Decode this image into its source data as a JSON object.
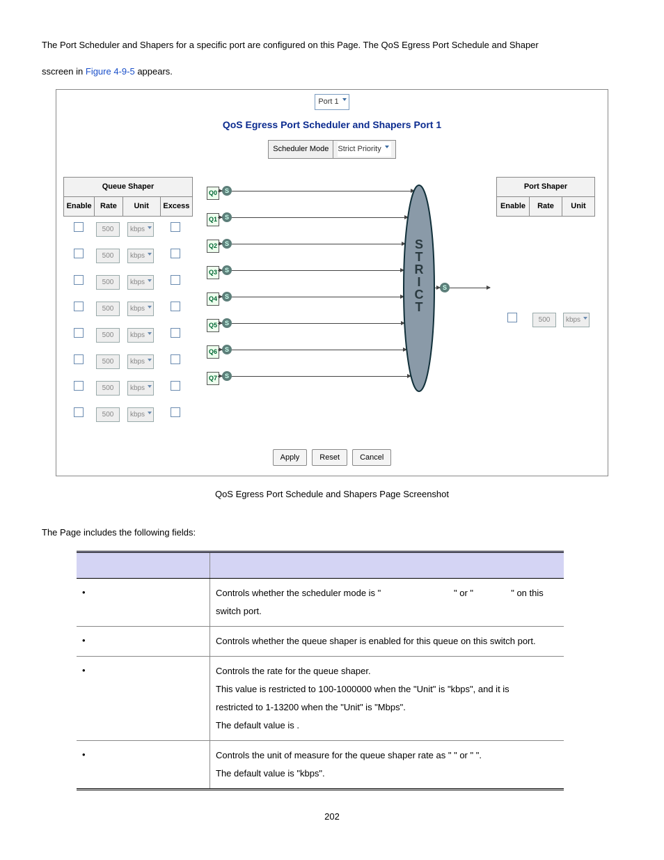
{
  "intro": {
    "line1_a": "The Port Scheduler and Shapers for a specific port are configured on this Page. The QoS Egress Port Schedule and Shaper",
    "line2_a": "sscreen in ",
    "figref": "Figure 4-9-5",
    "line2_b": " appears."
  },
  "ss": {
    "port_select": "Port 1",
    "title": "QoS Egress Port Scheduler and Shapers  Port 1",
    "sched_label": "Scheduler Mode",
    "sched_value": "Strict Priority",
    "queue_shaper_hdr": "Queue Shaper",
    "port_shaper_hdr": "Port Shaper",
    "cols": {
      "enable": "Enable",
      "rate": "Rate",
      "unit": "Unit",
      "excess": "Excess"
    },
    "rate_default": "500",
    "unit_default": "kbps",
    "queues": [
      "Q0",
      "Q1",
      "Q2",
      "Q3",
      "Q4",
      "Q5",
      "Q6",
      "Q7"
    ],
    "s_glyph": "S",
    "strict_text": "S\nT\nR\nI\nC\nT",
    "buttons": {
      "apply": "Apply",
      "reset": "Reset",
      "cancel": "Cancel"
    }
  },
  "caption": "QoS Egress Port Schedule and Shapers Page Screenshot",
  "fields_intro": "The Page includes the following fields:",
  "table_hdr": {
    "object": "",
    "description": ""
  },
  "rows": [
    {
      "obj": "",
      "desc_parts": [
        "Controls whether the scheduler mode is \"",
        "\" or \"",
        "\" on this switch port."
      ]
    },
    {
      "obj": "",
      "desc_parts": [
        "Controls whether the queue shaper is enabled for this queue on this switch port."
      ]
    },
    {
      "obj": "",
      "desc_parts": [
        "Controls the rate for the queue shaper.",
        "This value is restricted to 100-1000000 when the \"Unit\" is \"kbps\", and it is",
        "restricted to 1-13200 when the \"Unit\" is \"Mbps\".",
        "The default value is      ."
      ]
    },
    {
      "obj": "",
      "desc_parts": [
        "Controls the unit of measure for the queue shaper rate as \"       \" or \"       \".",
        "The default value is \"kbps\"."
      ]
    }
  ],
  "pagenum": "202"
}
